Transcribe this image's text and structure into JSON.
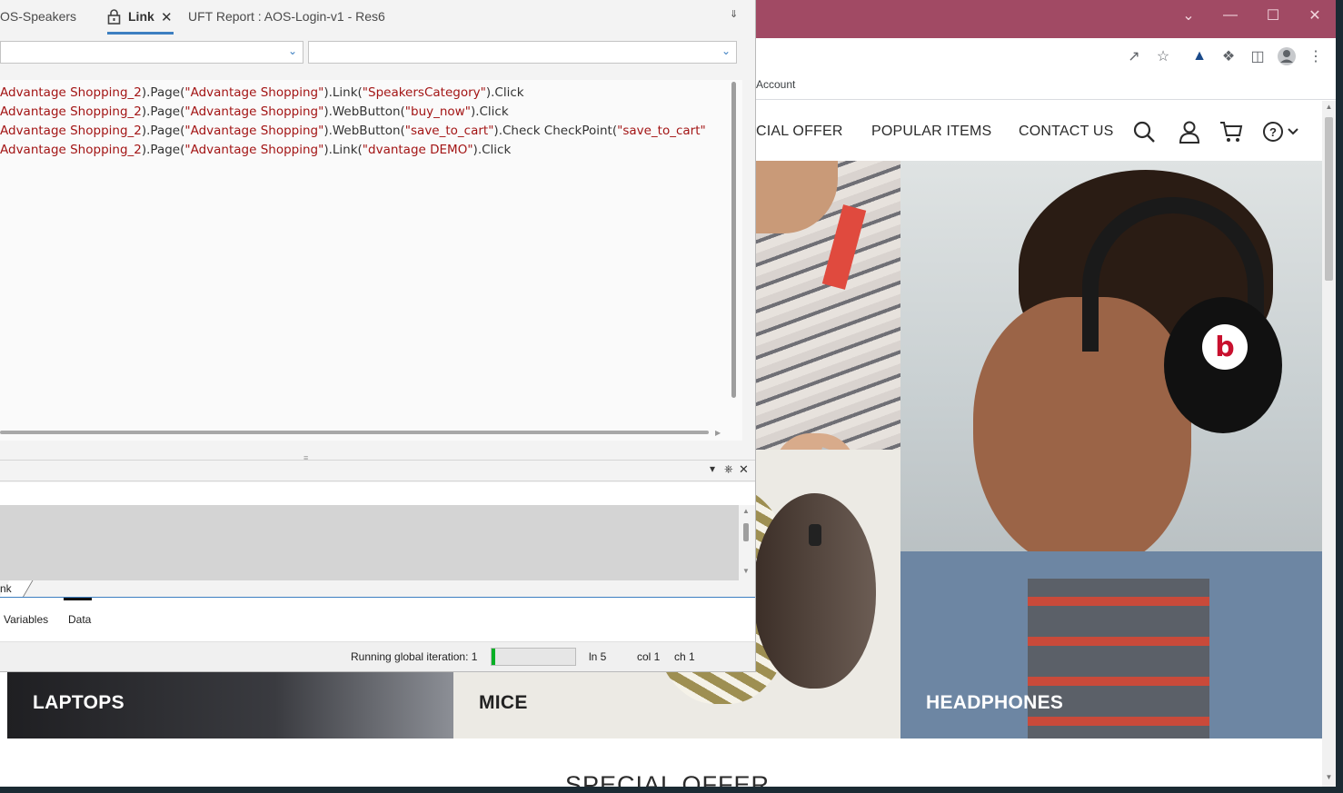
{
  "uft": {
    "tabs": [
      {
        "label": "OS-Speakers"
      },
      {
        "label": "Link"
      },
      {
        "label": "UFT Report : AOS-Login-v1 - Res6"
      }
    ],
    "code": [
      [
        {
          "t": "Advantage Shopping_2",
          "s": true
        },
        {
          "t": ").Page(",
          "s": false
        },
        {
          "t": "\"Advantage Shopping\"",
          "s": true
        },
        {
          "t": ").Link(",
          "s": false
        },
        {
          "t": "\"SpeakersCategory\"",
          "s": true
        },
        {
          "t": ").Click",
          "s": false
        }
      ],
      [
        {
          "t": "Advantage Shopping_2",
          "s": true
        },
        {
          "t": ").Page(",
          "s": false
        },
        {
          "t": "\"Advantage Shopping\"",
          "s": true
        },
        {
          "t": ").WebButton(",
          "s": false
        },
        {
          "t": "\"buy_now\"",
          "s": true
        },
        {
          "t": ").Click",
          "s": false
        }
      ],
      [
        {
          "t": "Advantage Shopping_2",
          "s": true
        },
        {
          "t": ").Page(",
          "s": false
        },
        {
          "t": "\"Advantage Shopping\"",
          "s": true
        },
        {
          "t": ").WebButton(",
          "s": false
        },
        {
          "t": "\"save_to_cart\"",
          "s": true
        },
        {
          "t": ").Check CheckPoint(",
          "s": false
        },
        {
          "t": "\"save_to_cart\"",
          "s": true
        }
      ],
      [
        {
          "t": "Advantage Shopping_2",
          "s": true
        },
        {
          "t": ").Page(",
          "s": false
        },
        {
          "t": "\"Advantage Shopping\"",
          "s": true
        },
        {
          "t": ").Link(",
          "s": false
        },
        {
          "t": "\"dvantage DEMO\"",
          "s": true
        },
        {
          "t": ").Click",
          "s": false
        }
      ]
    ],
    "sheet_tab": "nk",
    "bottom_tabs": {
      "variables": "Variables",
      "data": "Data"
    },
    "status": {
      "iteration": "Running global iteration: 1",
      "progress_fraction": 0.04,
      "ln": "ln 5",
      "col": "col 1",
      "ch": "ch 1"
    }
  },
  "browser": {
    "bookmark": "Account",
    "nav": {
      "special_offer": "CIAL OFFER",
      "popular_items": "POPULAR ITEMS",
      "contact_us": "CONTACT US"
    },
    "categories": {
      "laptops": "LAPTOPS",
      "mice": "MICE",
      "headphones": "HEADPHONES"
    },
    "special_offer_heading": "SPECIAL OFFER",
    "beats_logo": "b"
  },
  "colors": {
    "title_bar": "#a14a64",
    "code_string": "#a31515",
    "tab_accent": "#3d7fc1",
    "progress": "#06b025"
  }
}
